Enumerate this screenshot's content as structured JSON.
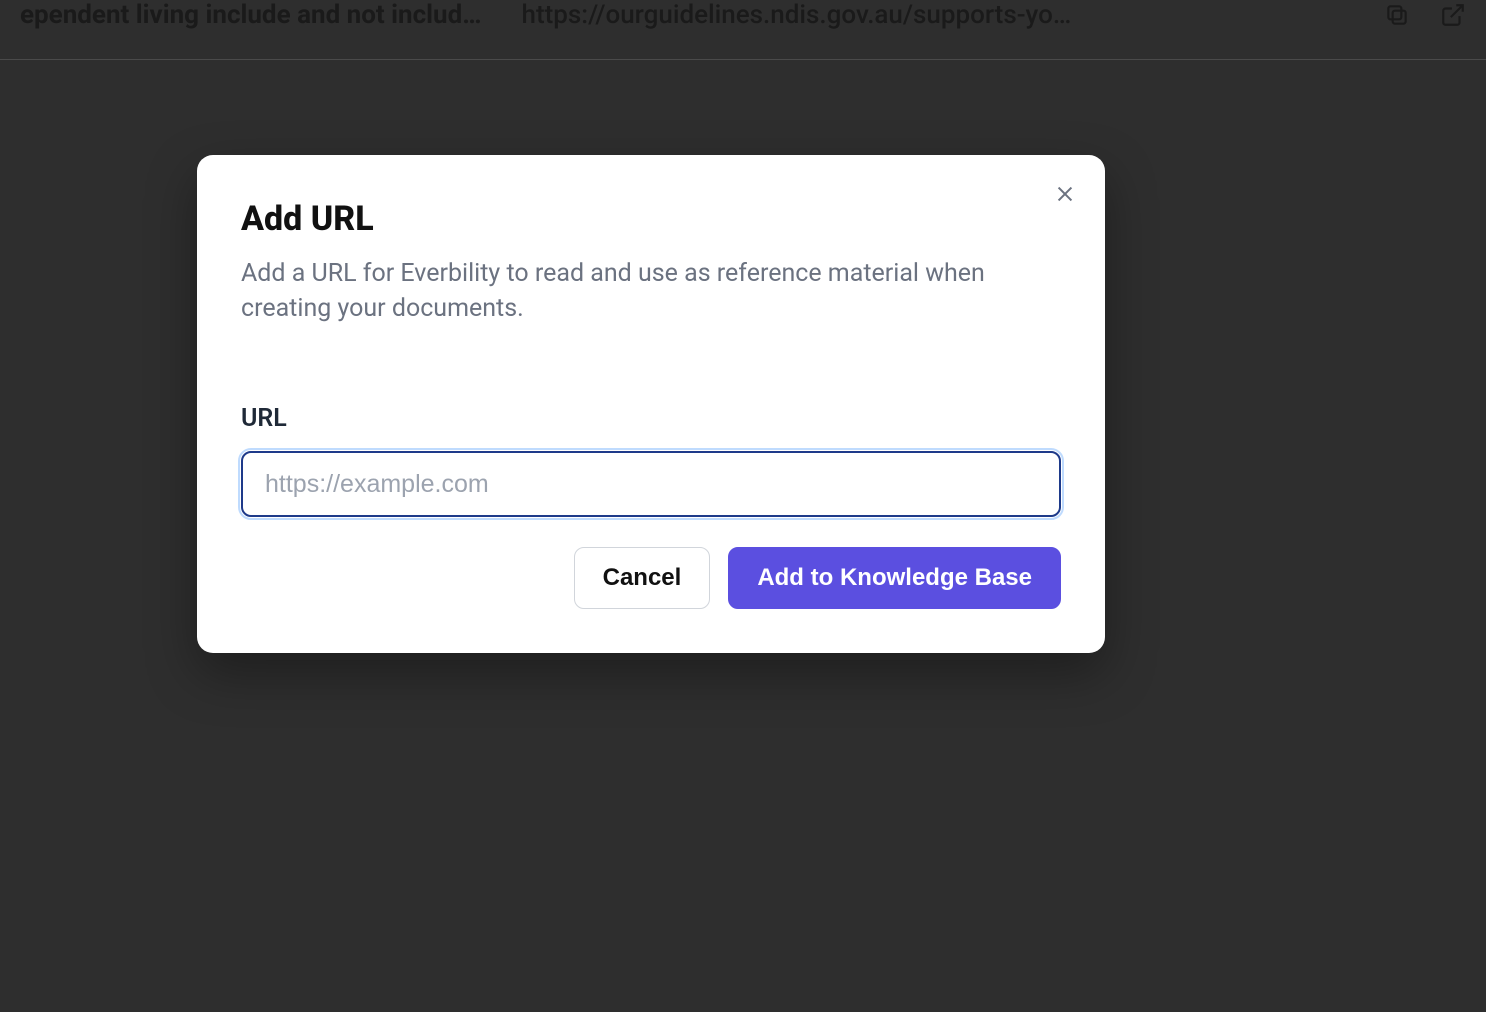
{
  "background": {
    "title_fragment": "ependent living include and not includ…",
    "url_fragment": "https://ourguidelines.ndis.gov.au/supports-yo…"
  },
  "modal": {
    "title": "Add URL",
    "description": "Add a URL for Everbility to read and use as reference material when creating your documents.",
    "field_label": "URL",
    "input_value": "",
    "input_placeholder": "https://example.com",
    "cancel_label": "Cancel",
    "submit_label": "Add to Knowledge Base"
  }
}
